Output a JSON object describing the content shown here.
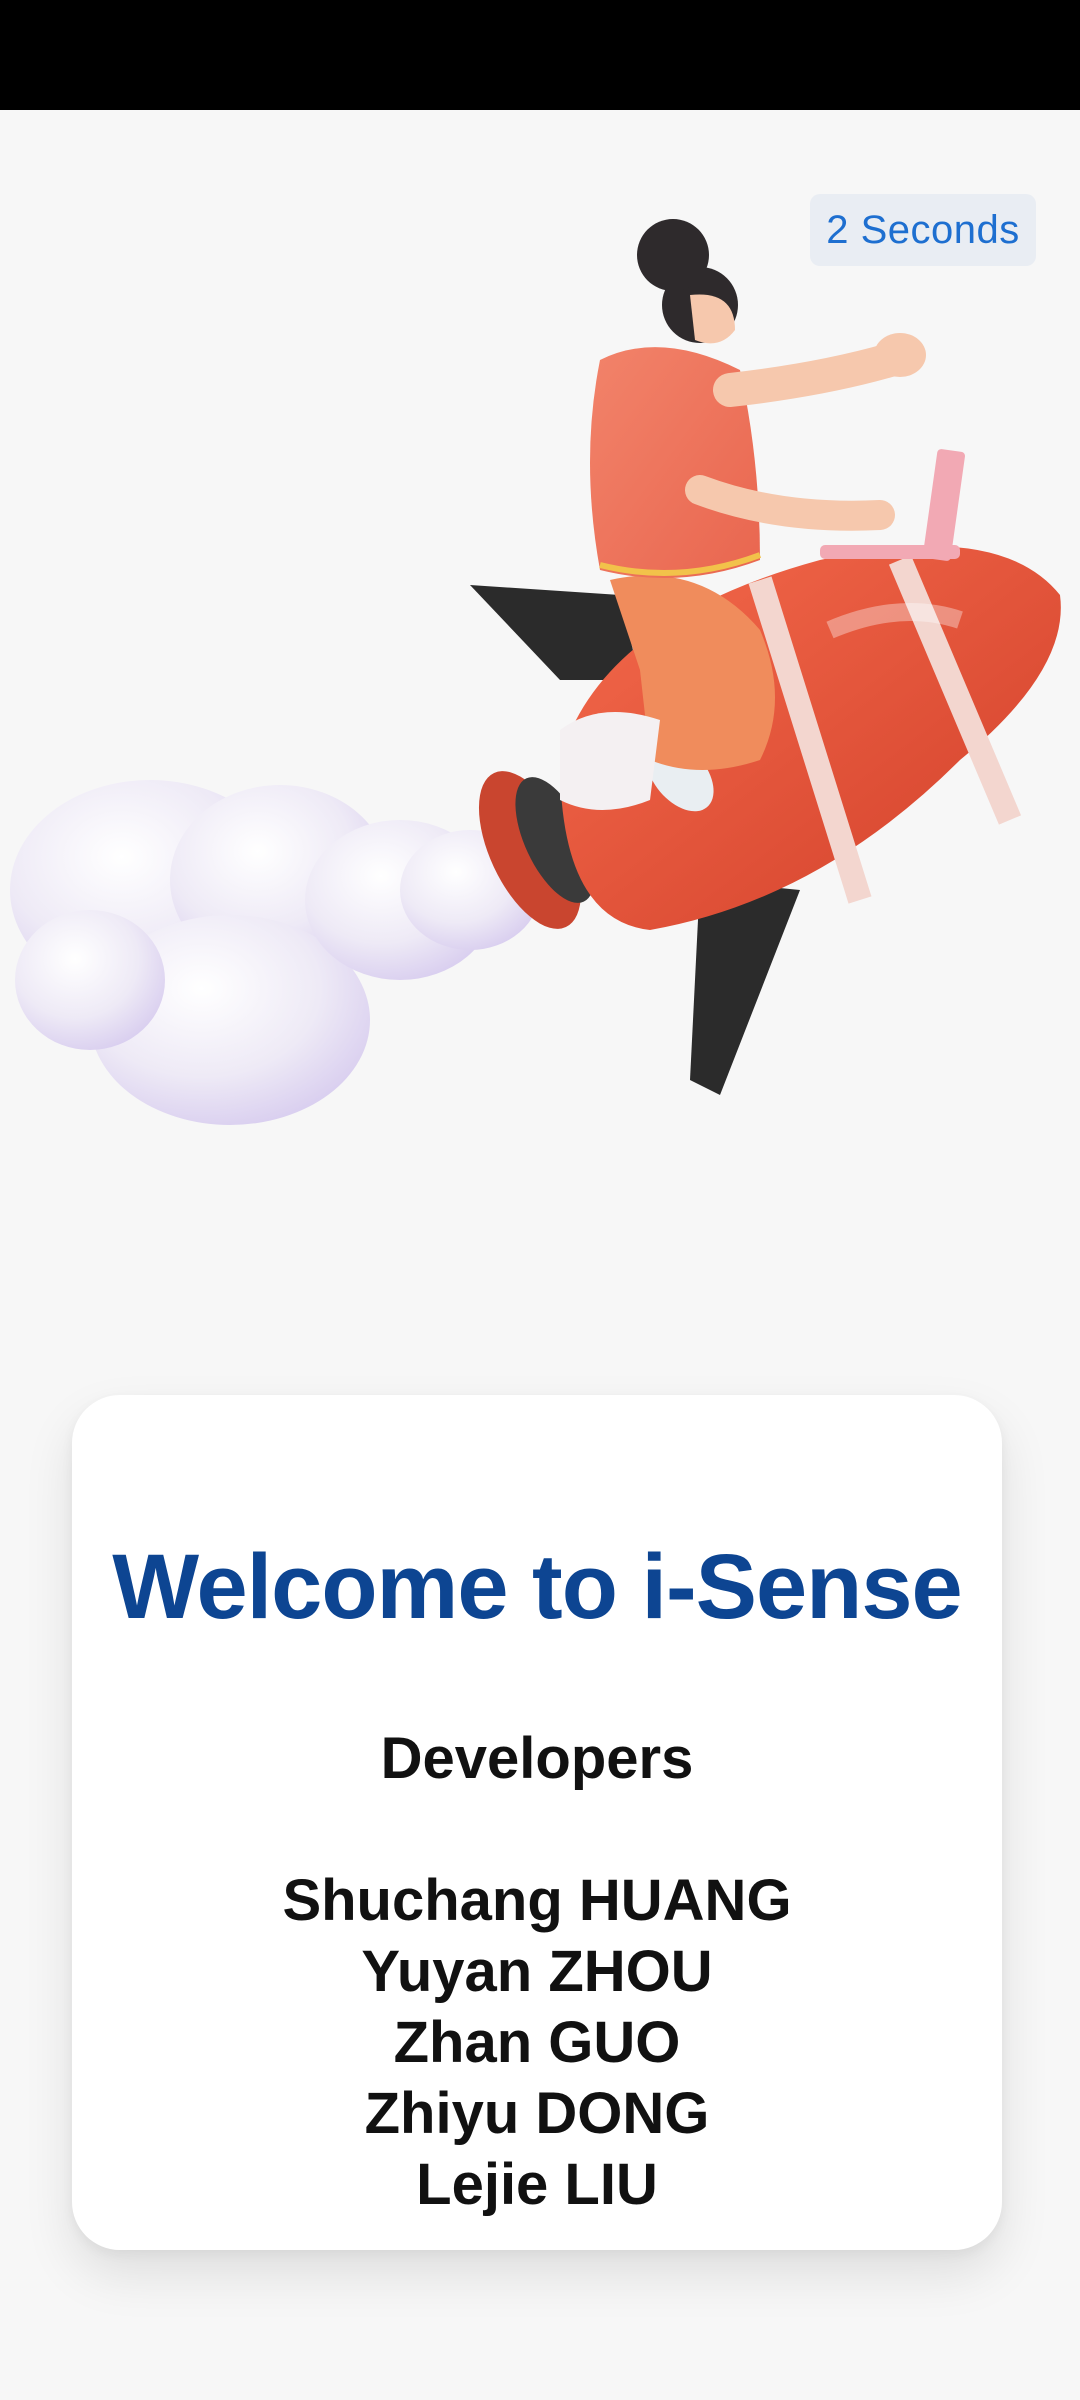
{
  "skip": {
    "label": "2 Seconds"
  },
  "illustration": {
    "icon": "rocket-rider-illustration",
    "colors": {
      "rocket": "#e8553a",
      "cloud": "#efeaf6",
      "fins": "#2b2b2b"
    }
  },
  "card": {
    "title": "Welcome to i-Sense",
    "developers_heading": "Developers",
    "developers": [
      "Shuchang HUANG",
      "Yuyan ZHOU",
      "Zhan GUO",
      "Zhiyu DONG",
      "Lejie LIU"
    ]
  },
  "colors": {
    "title": "#0d4592",
    "skip_text": "#1e6fd0",
    "background": "#f7f7f7"
  }
}
